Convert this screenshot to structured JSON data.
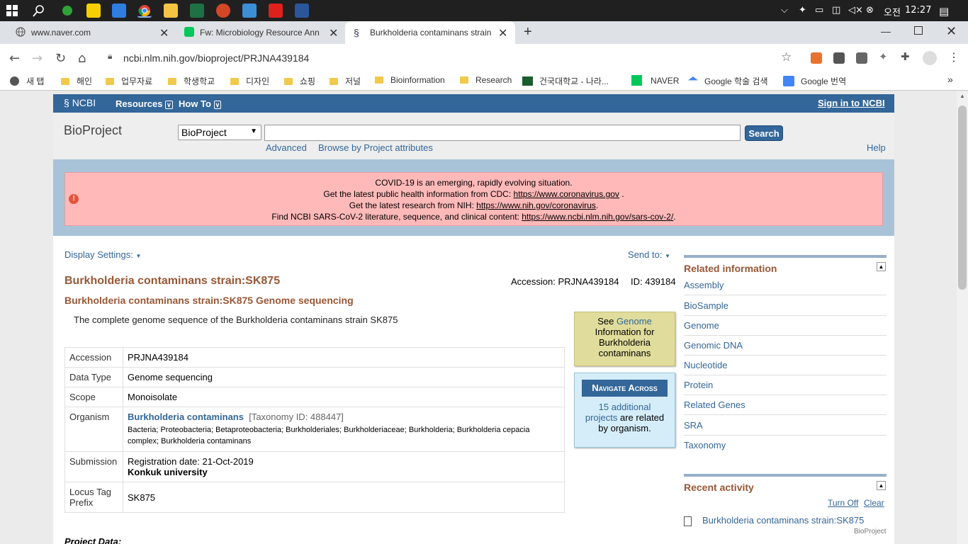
{
  "taskbar": {
    "ime": "오전",
    "time": "12:27"
  },
  "tabs": [
    {
      "title": "www.naver.com"
    },
    {
      "title": "Fw: Microbiology Resource Ann"
    },
    {
      "title": "Burkholderia contaminans strain"
    }
  ],
  "address": {
    "url": "ncbi.nlm.nih.gov/bioproject/PRJNA439184"
  },
  "bookmarks": [
    "새 탭",
    "해인",
    "업무자료",
    "학생학교",
    "디자인",
    "쇼핑",
    "저널",
    "Bioinformation",
    "Research",
    "건국대학교 - 나라...",
    "NAVER",
    "Google 학술 검색",
    "Google 번역"
  ],
  "ncbi": {
    "logo": "NCBI",
    "resources": "Resources",
    "howto": "How To",
    "signin": "Sign in to NCBI",
    "db_title": "BioProject",
    "db_select": "BioProject",
    "search_btn": "Search",
    "advanced": "Advanced",
    "browse": "Browse by Project attributes",
    "help": "Help"
  },
  "alert": {
    "l1": "COVID-19 is an emerging, rapidly evolving situation.",
    "l2": "Get the latest public health information from CDC: ",
    "l2_link": "https://www.coronavirus.gov",
    "l2_end": " .",
    "l3": "Get the latest research from NIH: ",
    "l3_link": "https://www.nih.gov/coronavirus",
    "l3_end": ".",
    "l4": "Find NCBI SARS-CoV-2 literature, sequence, and clinical content: ",
    "l4_link": "https://www.ncbi.nlm.nih.gov/sars-cov-2/",
    "l4_end": "."
  },
  "display_settings": "Display Settings:",
  "send_to": "Send to:",
  "record": {
    "title": "Burkholderia contaminans strain:SK875",
    "accession_label": "Accession: PRJNA439184",
    "id_label": "ID: 439184",
    "subtitle": "Burkholderia contaminans strain:SK875 Genome sequencing",
    "description": "The complete genome sequence of the Burkholderia contaminans strain SK875",
    "rows": {
      "accession_k": "Accession",
      "accession_v": "PRJNA439184",
      "datatype_k": "Data Type",
      "datatype_v": "Genome sequencing",
      "scope_k": "Scope",
      "scope_v": "Monoisolate",
      "organism_k": "Organism",
      "organism_v": "Burkholderia contaminans",
      "taxid": "[Taxonomy ID: 488447]",
      "lineage": "Bacteria; Proteobacteria; Betaproteobacteria; Burkholderiales; Burkholderiaceae; Burkholderia; Burkholderia cepacia complex; Burkholderia contaminans",
      "submission_k": "Submission",
      "reg_date": "Registration date: 21-Oct-2019",
      "submitter": "Konkuk university",
      "locus_k": "Locus Tag Prefix",
      "locus_v": "SK875"
    },
    "project_data": "Project Data:"
  },
  "genome_box": {
    "see": "See ",
    "link": "Genome",
    "rest": "Information for Burkholderia contaminans"
  },
  "navigate": {
    "title": "Navigate Across",
    "count_link": "15 additional projects",
    "rest": " are related by organism."
  },
  "related": {
    "heading": "Related information",
    "items": [
      "Assembly",
      "BioSample",
      "Genome",
      "Genomic DNA",
      "Nucleotide",
      "Protein",
      "Related Genes",
      "SRA",
      "Taxonomy"
    ]
  },
  "recent": {
    "heading": "Recent activity",
    "turn_off": "Turn Off",
    "clear": "Clear",
    "item": "Burkholderia contaminans strain:SK875",
    "item_db": "BioProject"
  }
}
